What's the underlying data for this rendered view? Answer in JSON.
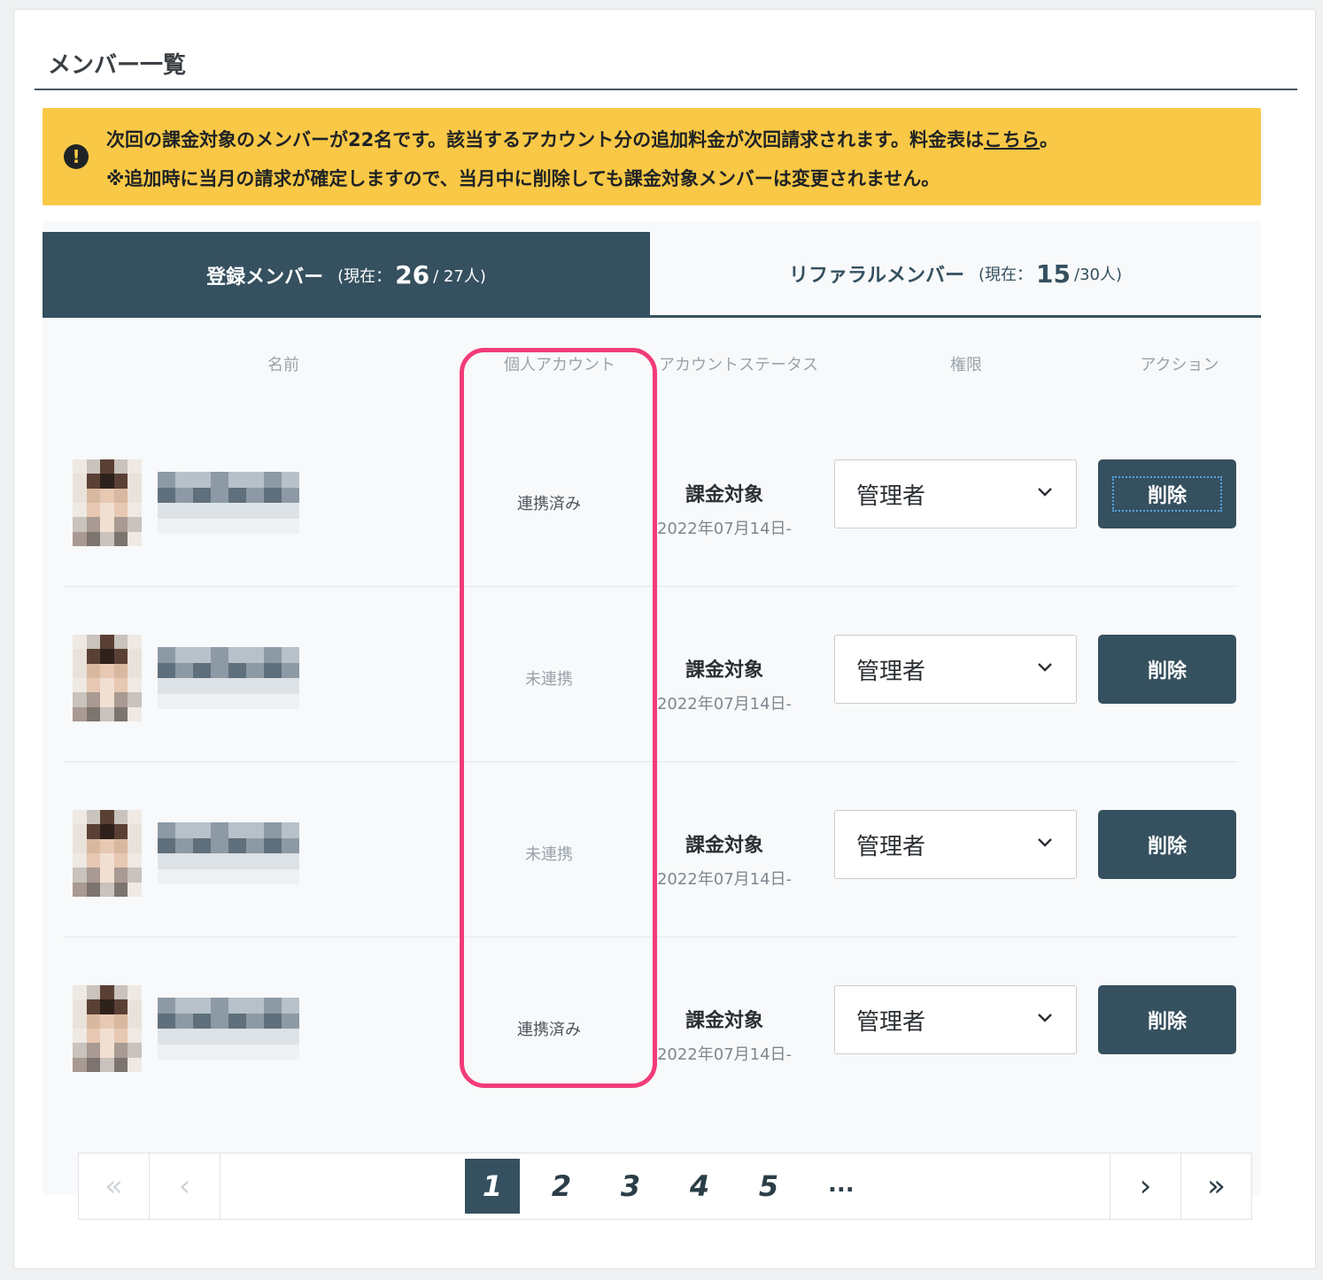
{
  "page": {
    "title": "メンバー一覧"
  },
  "notice": {
    "icon": "exclamation-icon",
    "line1_prefix": "次回の課金対象のメンバーが22名です。該当するアカウント分の追加料金が次回請求されます。料金表は",
    "line1_link": "こちら",
    "line1_suffix": "。",
    "line2": "※追加時に当月の請求が確定しますので、当月中に削除しても課金対象メンバーは変更されません。",
    "color": "#f9c846"
  },
  "tabs": [
    {
      "label": "登録メンバー",
      "count_prefix": "(現在：",
      "count": "26",
      "count_suffix": "/ 27人)"
    },
    {
      "label": "リファラルメンバー",
      "count_prefix": "(現在：",
      "count": "15",
      "count_suffix": "/30人)"
    }
  ],
  "columns": {
    "name": "名前",
    "personal_account": "個人アカウント",
    "account_status": "アカウントステータス",
    "role": "権限",
    "action": "アクション"
  },
  "members": [
    {
      "link_status": "連携済み",
      "status": "課金対象",
      "date": "2022年07月14日-",
      "role": "管理者",
      "action": "削除"
    },
    {
      "link_status": "未連携",
      "status": "課金対象",
      "date": "2022年07月14日-",
      "role": "管理者",
      "action": "削除"
    },
    {
      "link_status": "未連携",
      "status": "課金対象",
      "date": "2022年07月14日-",
      "role": "管理者",
      "action": "削除"
    },
    {
      "link_status": "連携済み",
      "status": "課金対象",
      "date": "2022年07月14日-",
      "role": "管理者",
      "action": "削除"
    }
  ],
  "pagination": {
    "pages": [
      "1",
      "2",
      "3",
      "4",
      "5"
    ],
    "ellipsis": "...",
    "first": "«",
    "prev": "‹",
    "next": "›",
    "last": "»"
  },
  "colors": {
    "primary": "#35505f",
    "highlight": "#f23b7a"
  }
}
